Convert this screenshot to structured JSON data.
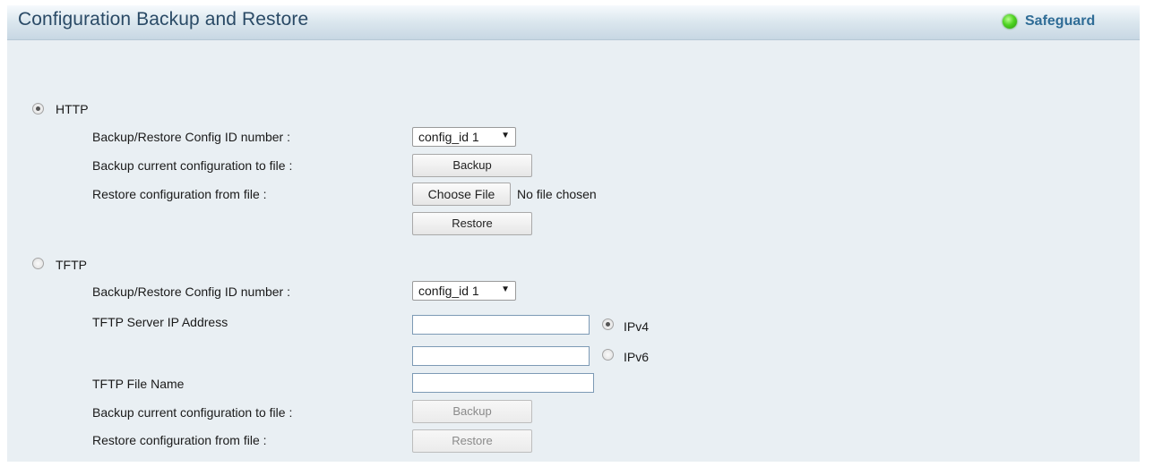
{
  "header": {
    "title": "Configuration Backup and Restore",
    "status_label": "Safeguard",
    "status_color": "#3ec31a"
  },
  "http": {
    "label": "HTTP",
    "selected": true,
    "config_id_label": "Backup/Restore Config ID number :",
    "config_id_value": "config_id 1",
    "backup_label": "Backup current configuration to file :",
    "backup_button": "Backup",
    "restore_label": "Restore configuration from file :",
    "choose_file_button": "Choose File",
    "file_status": "No file chosen",
    "restore_button": "Restore"
  },
  "tftp": {
    "label": "TFTP",
    "selected": false,
    "config_id_label": "Backup/Restore Config ID number :",
    "config_id_value": "config_id 1",
    "server_ip_label": "TFTP Server IP Address",
    "ipv4_value": "",
    "ipv4_label": "IPv4",
    "ipv6_value": "",
    "ipv6_label": "IPv6",
    "file_name_label": "TFTP File Name",
    "file_name_value": "",
    "backup_label": "Backup current configuration to file :",
    "backup_button": "Backup",
    "restore_label": "Restore configuration from file :",
    "restore_button": "Restore"
  }
}
